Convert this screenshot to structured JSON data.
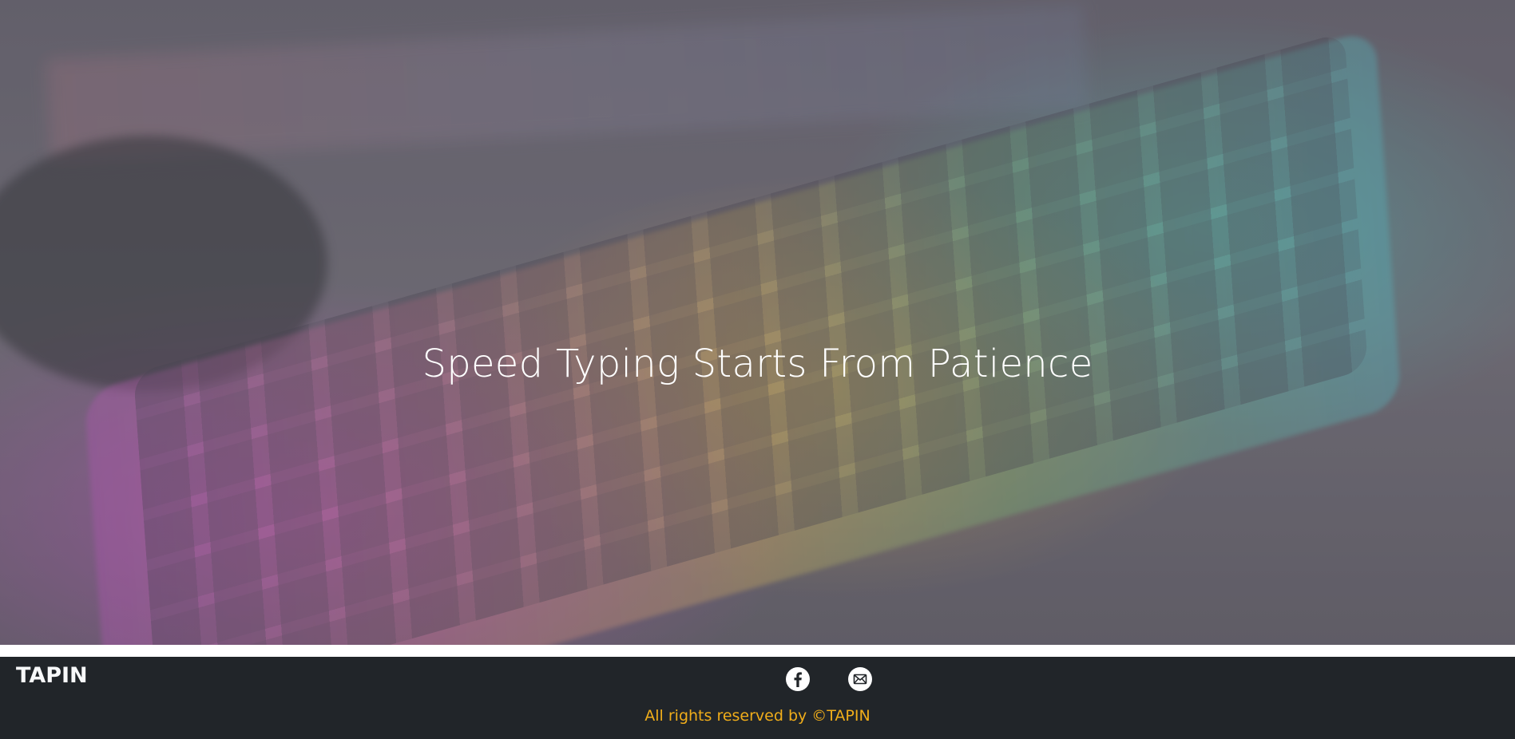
{
  "hero": {
    "title": "Speed Typing Starts From Patience"
  },
  "footer": {
    "brand": "TAPIN",
    "social": [
      {
        "icon": "facebook-icon"
      },
      {
        "icon": "envelope-icon"
      }
    ],
    "copyright": "All rights reserved by ©TAPIN"
  },
  "colors": {
    "footer_bg": "#212529",
    "copyright_text": "#f0ad1a",
    "hero_text": "#ffffff"
  }
}
